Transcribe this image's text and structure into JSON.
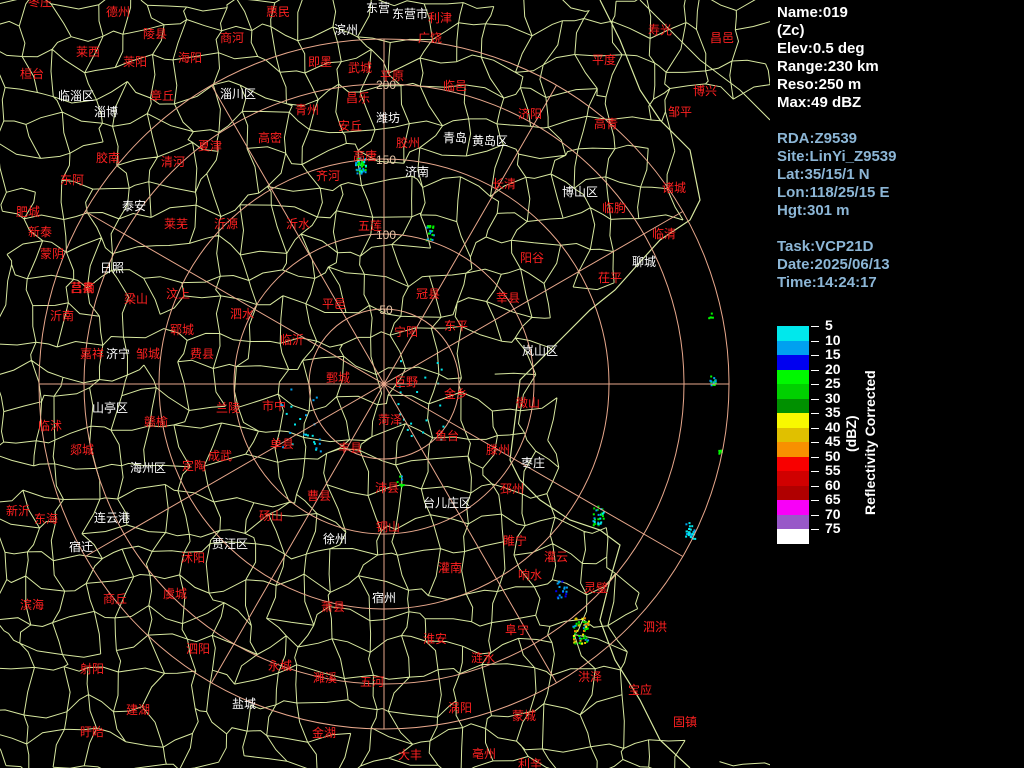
{
  "radar_info": {
    "name": "Name:019",
    "product": "(Zc)",
    "elev": "Elev:0.5 deg",
    "range": "Range:230 km",
    "reso": "Reso:250 m",
    "max": "Max:49 dBZ",
    "rda": "RDA:Z9539",
    "site": "Site:LinYi_Z9539",
    "lat": "Lat:35/15/1 N",
    "lon": "Lon:118/25/15 E",
    "hgt": "Hgt:301 m",
    "task": "Task:VCP21D",
    "date": "Date:2025/06/13",
    "time": "Time:14:24:17"
  },
  "legend": {
    "title": "Reflectivity Corrected",
    "unit": "(dBZ)",
    "entries": [
      {
        "value": "5",
        "color": "#00e8ec"
      },
      {
        "value": "10",
        "color": "#00a0f0"
      },
      {
        "value": "15",
        "color": "#0000f0"
      },
      {
        "value": "20",
        "color": "#00f800"
      },
      {
        "value": "25",
        "color": "#00d000"
      },
      {
        "value": "30",
        "color": "#009000"
      },
      {
        "value": "35",
        "color": "#f8f800"
      },
      {
        "value": "40",
        "color": "#e0c000"
      },
      {
        "value": "45",
        "color": "#f89000"
      },
      {
        "value": "50",
        "color": "#f80000"
      },
      {
        "value": "55",
        "color": "#d00000"
      },
      {
        "value": "60",
        "color": "#b00000"
      },
      {
        "value": "65",
        "color": "#f800f8"
      },
      {
        "value": "70",
        "color": "#9858c8"
      },
      {
        "value": "75",
        "color": "#ffffff"
      }
    ]
  },
  "range_rings": {
    "labels": [
      "50",
      "100",
      "150",
      "200"
    ],
    "color": "#e8a88c"
  },
  "map": {
    "boundary_color": "#d8e8a0",
    "county_color": "#ff2020",
    "city_color": "#ffffff",
    "county_labels": [
      "枣庄",
      "德州",
      "陵县",
      "商河",
      "惠民",
      "东营",
      "东营市",
      "广饶",
      "寿光",
      "昌邑",
      "平度",
      "莱西",
      "莱阳",
      "海阳",
      "即墨",
      "武城",
      "平原",
      "临邑",
      "济阳",
      "高青",
      "博兴",
      "邹平",
      "章丘",
      "淄川",
      "青州",
      "昌乐",
      "安丘",
      "高密",
      "胶州",
      "清河",
      "夏津",
      "高唐",
      "齐河",
      "长清",
      "平阴",
      "东阿",
      "阳谷",
      "莘县",
      "冠县",
      "聊城",
      "东平",
      "梁山",
      "汶上",
      "宁阳",
      "新泰",
      "蒙阴",
      "沂源",
      "沂水",
      "莒县",
      "五莲",
      "诸城",
      "日照",
      "莒南",
      "临沭",
      "郯城",
      "兰陵",
      "费县",
      "平邑",
      "泗水",
      "曲阜",
      "邹城",
      "滕州",
      "微山",
      "鱼台",
      "金乡",
      "嘉祥",
      "巨野",
      "郓城",
      "单县",
      "成武",
      "曹县",
      "东明",
      "定陶",
      "鄄城",
      "砀山",
      "萧县",
      "沛县",
      "丰县",
      "邳州",
      "新沂",
      "睢宁",
      "宿迁",
      "沭阳",
      "泗阳",
      "泗洪",
      "灌云",
      "灌南",
      "响水",
      "滨海",
      "射阳",
      "阜宁",
      "建湖",
      "涟水",
      "淮安",
      "宝应",
      "金湖",
      "盱眙",
      "五河",
      "固镇",
      "怀远",
      "蒙城",
      "利辛",
      "涡阳",
      "亳州",
      "永城",
      "夏邑",
      "虞城",
      "商丘",
      "宁陵",
      "睢县",
      "柘城",
      "大丰",
      "黄岛区",
      "胶南",
      "青岛",
      "即墨市",
      "莱州",
      "招远",
      "栖霞",
      "蓬莱",
      "龙口",
      "安丘市",
      "临朐",
      "沂南",
      "兰山区",
      "罗庄区",
      "河东区",
      "苍山",
      "新泰市",
      "莱芜",
      "泰安",
      "肥城",
      "宁阳县",
      "兖州",
      "济宁",
      "汶上县",
      "梁山县",
      "东平县",
      "平阴县",
      "长清区",
      "历城区",
      "章丘市",
      "邹平县",
      "周村区",
      "博山区",
      "淄川区",
      "沂源县",
      "蒙阴县",
      "平邑县",
      "费县县",
      "临沂",
      "日照市",
      "五莲县",
      "诸城市",
      "高密市",
      "胶州市",
      "黄岛",
      "菏泽",
      "嘉祥县",
      "鱼台县",
      "金乡县",
      "单县县",
      "曹县县",
      "成武县",
      "巨野县",
      "郓城县",
      "鄄城县",
      "东明县",
      "定陶县",
      "徐州",
      "铜山",
      "沛县县",
      "丰县县",
      "睢宁县",
      "新沂市",
      "邳州市",
      "宿迁市",
      "泗洪县",
      "泗阳县",
      "沭阳县",
      "灌南县",
      "灌云县",
      "响水县",
      "滨海县",
      "阜宁县",
      "射阳县",
      "建湖县",
      "盐城",
      "涟水县",
      "淮安市",
      "洪泽",
      "宝应县",
      "金湖县",
      "盱眙县",
      "高邮"
    ],
    "city_labels": [
      "东营",
      "东营市",
      "滨州",
      "淄博",
      "临淄区",
      "潍坊",
      "博山区",
      "莱芜",
      "济南",
      "聊城",
      "泰安",
      "新泰",
      "蒙阴",
      "沂南",
      "临沂",
      "河东区",
      "兰山区",
      "罗庄区",
      "费县",
      "平邑",
      "山亭区",
      "枣庄",
      "台儿庄区",
      "贾汪区",
      "徐州",
      "邳州",
      "新沂",
      "东海",
      "连云港",
      "海州区",
      "连云区",
      "灌云",
      "赣榆",
      "日照",
      "岚山区",
      "莒南",
      "莒县",
      "沂水",
      "五莲",
      "诸城",
      "青岛",
      "黄岛区",
      "胶南",
      "胶州",
      "高密",
      "安丘",
      "昌邑",
      "寿光",
      "青州",
      "临朐",
      "昌乐",
      "沂源",
      "淄川区",
      "周村区",
      "博兴",
      "高青",
      "邹平",
      "章丘",
      "济阳",
      "商河",
      "德州",
      "宿迁",
      "沭阳",
      "淮安",
      "盐城",
      "宝应",
      "涟水",
      "灌南",
      "响水",
      "滨海",
      "阜宁",
      "射阳",
      "建湖",
      "洪泽",
      "盱眙",
      "金湖",
      "泗洪",
      "泗阳",
      "睢宁",
      "铜山",
      "沛县",
      "丰县",
      "宿州",
      "濉溪",
      "萧县",
      "砀山",
      "永城",
      "夏邑",
      "虞城",
      "商丘",
      "柘城",
      "淮北",
      "亳州"
    ]
  },
  "labels_on_map": [
    {
      "t": "枣庄",
      "c": "r"
    },
    {
      "t": "德州",
      "c": "r"
    },
    {
      "t": "陵县",
      "c": "r"
    },
    {
      "t": "商河",
      "c": "r"
    },
    {
      "t": "惠民",
      "c": "r"
    },
    {
      "t": "东营",
      "c": "w"
    },
    {
      "t": "东营市",
      "c": "w"
    },
    {
      "t": "利津",
      "c": "r"
    },
    {
      "t": "滨州",
      "c": "w"
    },
    {
      "t": "广饶",
      "c": "r"
    },
    {
      "t": "寿光",
      "c": "r"
    },
    {
      "t": "昌邑",
      "c": "r"
    },
    {
      "t": "平度",
      "c": "r"
    },
    {
      "t": "莱西",
      "c": "r"
    },
    {
      "t": "莱阳",
      "c": "r"
    },
    {
      "t": "海阳",
      "c": "r"
    },
    {
      "t": "即墨",
      "c": "r"
    },
    {
      "t": "武城",
      "c": "r"
    },
    {
      "t": "平原",
      "c": "r"
    },
    {
      "t": "临邑",
      "c": "r"
    },
    {
      "t": "济阳",
      "c": "r"
    },
    {
      "t": "高青",
      "c": "r"
    },
    {
      "t": "博兴",
      "c": "r"
    },
    {
      "t": "邹平",
      "c": "r"
    },
    {
      "t": "桓台",
      "c": "r"
    },
    {
      "t": "临淄区",
      "c": "w"
    },
    {
      "t": "淄博",
      "c": "w"
    },
    {
      "t": "章丘",
      "c": "r"
    },
    {
      "t": "淄川区",
      "c": "w"
    },
    {
      "t": "青州",
      "c": "r"
    },
    {
      "t": "昌乐",
      "c": "r"
    },
    {
      "t": "潍坊",
      "c": "w"
    },
    {
      "t": "安丘",
      "c": "r"
    },
    {
      "t": "高密",
      "c": "r"
    },
    {
      "t": "胶州",
      "c": "r"
    },
    {
      "t": "青岛",
      "c": "w"
    },
    {
      "t": "黄岛区",
      "c": "w"
    },
    {
      "t": "胶南",
      "c": "r"
    },
    {
      "t": "清河",
      "c": "r"
    },
    {
      "t": "夏津",
      "c": "r"
    },
    {
      "t": "高唐",
      "c": "r"
    },
    {
      "t": "齐河",
      "c": "r"
    },
    {
      "t": "济南",
      "c": "w"
    },
    {
      "t": "长清",
      "c": "r"
    },
    {
      "t": "博山区",
      "c": "w"
    },
    {
      "t": "临朐",
      "c": "r"
    },
    {
      "t": "诸城",
      "c": "r"
    },
    {
      "t": "临清",
      "c": "r"
    },
    {
      "t": "聊城",
      "c": "w"
    },
    {
      "t": "茌平",
      "c": "r"
    },
    {
      "t": "东阿",
      "c": "r"
    },
    {
      "t": "肥城",
      "c": "r"
    },
    {
      "t": "泰安",
      "c": "w"
    },
    {
      "t": "莱芜",
      "c": "r"
    },
    {
      "t": "沂源",
      "c": "r"
    },
    {
      "t": "沂水",
      "c": "r"
    },
    {
      "t": "五莲",
      "c": "r"
    },
    {
      "t": "冠县",
      "c": "r"
    },
    {
      "t": "阳谷",
      "c": "r"
    },
    {
      "t": "莘县",
      "c": "r"
    },
    {
      "t": "东平",
      "c": "r"
    },
    {
      "t": "宁阳",
      "c": "r"
    },
    {
      "t": "新泰",
      "c": "r"
    },
    {
      "t": "蒙阴",
      "c": "r"
    },
    {
      "t": "莒县",
      "c": "r"
    },
    {
      "t": "日照",
      "c": "w"
    },
    {
      "t": "梁山",
      "c": "r"
    },
    {
      "t": "汶上",
      "c": "r"
    },
    {
      "t": "泗水",
      "c": "r"
    },
    {
      "t": "平邑",
      "c": "r"
    },
    {
      "t": "沂南",
      "c": "r"
    },
    {
      "t": "莒南",
      "c": "r"
    },
    {
      "t": "郓城",
      "c": "r"
    },
    {
      "t": "嘉祥",
      "c": "r"
    },
    {
      "t": "济宁",
      "c": "w"
    },
    {
      "t": "邹城",
      "c": "r"
    },
    {
      "t": "费县",
      "c": "r"
    },
    {
      "t": "临沂",
      "c": "r"
    },
    {
      "t": "岚山区",
      "c": "w"
    },
    {
      "t": "鄄城",
      "c": "r"
    },
    {
      "t": "巨野",
      "c": "r"
    },
    {
      "t": "金乡",
      "c": "r"
    },
    {
      "t": "微山",
      "c": "r"
    },
    {
      "t": "山亭区",
      "c": "w"
    },
    {
      "t": "市中",
      "c": "r"
    },
    {
      "t": "兰陵",
      "c": "r"
    },
    {
      "t": "临沭",
      "c": "r"
    },
    {
      "t": "赣榆",
      "c": "r"
    },
    {
      "t": "菏泽",
      "c": "r"
    },
    {
      "t": "鱼台",
      "c": "r"
    },
    {
      "t": "滕州",
      "c": "r"
    },
    {
      "t": "枣庄",
      "c": "w"
    },
    {
      "t": "郯城",
      "c": "r"
    },
    {
      "t": "海州区",
      "c": "w"
    },
    {
      "t": "定陶",
      "c": "r"
    },
    {
      "t": "成武",
      "c": "r"
    },
    {
      "t": "单县",
      "c": "r"
    },
    {
      "t": "丰县",
      "c": "r"
    },
    {
      "t": "沛县",
      "c": "r"
    },
    {
      "t": "台儿庄区",
      "c": "w"
    },
    {
      "t": "邳州",
      "c": "r"
    },
    {
      "t": "新沂",
      "c": "r"
    },
    {
      "t": "东海",
      "c": "r"
    },
    {
      "t": "连云港",
      "c": "w"
    },
    {
      "t": "曹县",
      "c": "r"
    },
    {
      "t": "砀山",
      "c": "r"
    },
    {
      "t": "贾汪区",
      "c": "w"
    },
    {
      "t": "徐州",
      "c": "w"
    },
    {
      "t": "铜山",
      "c": "r"
    },
    {
      "t": "睢宁",
      "c": "r"
    },
    {
      "t": "宿迁",
      "c": "w"
    },
    {
      "t": "沭阳",
      "c": "r"
    },
    {
      "t": "灌云",
      "c": "r"
    },
    {
      "t": "灌南",
      "c": "r"
    },
    {
      "t": "响水",
      "c": "r"
    },
    {
      "t": "滨海",
      "c": "r"
    },
    {
      "t": "商丘",
      "c": "r"
    },
    {
      "t": "虞城",
      "c": "r"
    },
    {
      "t": "萧县",
      "c": "r"
    },
    {
      "t": "宿州",
      "c": "w"
    },
    {
      "t": "灵璧",
      "c": "r"
    },
    {
      "t": "泗洪",
      "c": "r"
    },
    {
      "t": "泗阳",
      "c": "r"
    },
    {
      "t": "淮安",
      "c": "r"
    },
    {
      "t": "涟水",
      "c": "r"
    },
    {
      "t": "阜宁",
      "c": "r"
    },
    {
      "t": "射阳",
      "c": "r"
    },
    {
      "t": "永城",
      "c": "r"
    },
    {
      "t": "濉溪",
      "c": "r"
    },
    {
      "t": "五河",
      "c": "r"
    },
    {
      "t": "洪泽",
      "c": "r"
    },
    {
      "t": "宝应",
      "c": "r"
    },
    {
      "t": "建湖",
      "c": "r"
    },
    {
      "t": "盐城",
      "c": "w"
    },
    {
      "t": "涡阳",
      "c": "r"
    },
    {
      "t": "蒙城",
      "c": "r"
    },
    {
      "t": "固镇",
      "c": "r"
    },
    {
      "t": "盱眙",
      "c": "r"
    },
    {
      "t": "金湖",
      "c": "r"
    },
    {
      "t": "大丰",
      "c": "r"
    },
    {
      "t": "亳州",
      "c": "r"
    },
    {
      "t": "利辛",
      "c": "r"
    },
    {
      "t": "怀远",
      "c": "r"
    },
    {
      "t": "沂源",
      "c": "w"
    },
    {
      "t": "东营",
      "c": "r"
    },
    {
      "t": "周村区",
      "c": "w"
    },
    {
      "t": "淄博",
      "c": "w"
    },
    {
      "t": "沂南",
      "c": "w"
    },
    {
      "t": "兰山区",
      "c": "w"
    },
    {
      "t": "罗庄区",
      "c": "w"
    },
    {
      "t": "河东区",
      "c": "w"
    }
  ]
}
